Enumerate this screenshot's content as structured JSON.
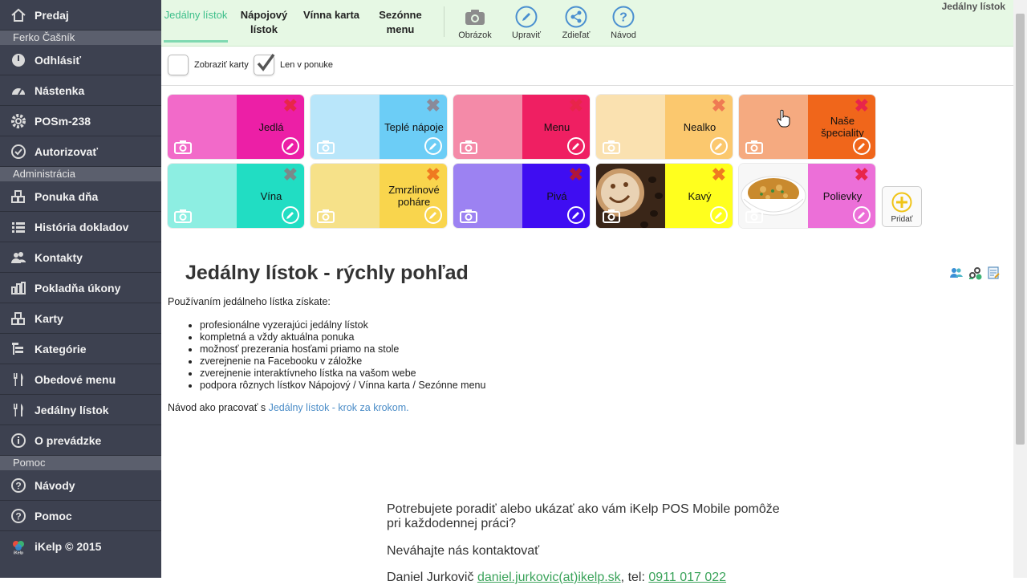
{
  "sidebar": {
    "items": [
      {
        "label": "Predaj",
        "icon": "home-icon"
      },
      {
        "section": "Ferko Čašník"
      },
      {
        "label": "Odhlásiť",
        "icon": "power-icon"
      },
      {
        "label": "Nástenka",
        "icon": "dashboard-icon"
      },
      {
        "label": "POSm-238",
        "icon": "gear-icon"
      },
      {
        "label": "Autorizovať",
        "icon": "check-circle-icon"
      },
      {
        "section": "Administrácia"
      },
      {
        "label": "Ponuka dňa",
        "icon": "blocks-star-icon"
      },
      {
        "label": "História dokladov",
        "icon": "list-icon"
      },
      {
        "label": "Kontakty",
        "icon": "users-icon"
      },
      {
        "label": "Pokladňa úkony",
        "icon": "bars-icon"
      },
      {
        "label": "Karty",
        "icon": "boxes-icon"
      },
      {
        "label": "Kategórie",
        "icon": "tree-icon"
      },
      {
        "label": "Obedové menu",
        "icon": "cutlery-icon"
      },
      {
        "label": "Jedálny lístok",
        "icon": "cutlery-icon"
      },
      {
        "label": "O prevádzke",
        "icon": "info-icon"
      },
      {
        "section": "Pomoc"
      },
      {
        "label": "Návody",
        "icon": "question-icon"
      },
      {
        "label": "Pomoc",
        "icon": "question-icon"
      },
      {
        "label": "iKelp © 2015",
        "icon": "ikelp-logo",
        "logo_text": "iKelp"
      }
    ]
  },
  "topbar": {
    "tabs": [
      {
        "label": "Jedálny lístok",
        "active": true
      },
      {
        "label": "Nápojový lístok"
      },
      {
        "label": "Vínna karta"
      },
      {
        "label": "Sezónne menu"
      }
    ],
    "tools": [
      {
        "label": "Obrázok",
        "icon": "camera-icon"
      },
      {
        "label": "Upraviť",
        "icon": "pencil-icon"
      },
      {
        "label": "Zdieľať",
        "icon": "share-icon"
      },
      {
        "label": "Návod",
        "icon": "help-icon"
      }
    ],
    "title": "Jedálny lístok"
  },
  "filters": {
    "show_cards": "Zobraziť karty",
    "show_cards_checked": false,
    "only_in_menu": "Len v ponuke",
    "only_in_menu_checked": true
  },
  "tiles": [
    {
      "label": "Jedlá",
      "left": "#f26ac9",
      "right": "#ec1fa6",
      "x": "#e8254a"
    },
    {
      "label": "Teplé nápoje",
      "left": "#b9e6fa",
      "right": "#6ccdf6",
      "x": "#8a8a99"
    },
    {
      "label": "Menu",
      "left": "#f48aa8",
      "right": "#ef1f62",
      "x": "#e8254a"
    },
    {
      "label": "Nealko",
      "left": "#fae1b0",
      "right": "#fbc86e",
      "x": "#ef7a53"
    },
    {
      "label": "Naše špeciality",
      "left": "#f5aa80",
      "right": "#f0661b",
      "x": "#e8254a"
    },
    {
      "label": "Vína",
      "left": "#8deee2",
      "right": "#21ddc3",
      "x": "#7a8a8a"
    },
    {
      "label": "Zmrzlinové poháre",
      "left": "#f6e189",
      "right": "#f9d54d",
      "x": "#ef7a20"
    },
    {
      "label": "Pivá",
      "left": "#9c82f2",
      "right": "#3f0df2",
      "x": "#b0163a"
    },
    {
      "label": "Kavý",
      "left": "#6b4a32",
      "right": "#ffff1e",
      "x": "#ef7a20",
      "photo": "coffee"
    },
    {
      "label": "Polievky",
      "left": "#f4f4f4",
      "right": "#ec6fd8",
      "x": "#e8254a",
      "photo": "soup"
    }
  ],
  "add_label": "Pridať",
  "content": {
    "heading": "Jedálny lístok - rýchly pohľad",
    "intro": "Používaním jedálneho lístka získate:",
    "benefits": [
      "profesionálne vyzerajúci jedálny lístok",
      "kompletná a vždy aktuálna ponuka",
      "možnosť prezerania hosťami priamo na stole",
      "zverejnenie na Facebooku v záložke",
      "zverejnenie interaktívneho lístka na vašom webe",
      "podpora rôznych lístkov Nápojový / Vínna karta / Sezónne menu"
    ],
    "guide_prefix": "Návod ako pracovať s ",
    "guide_link": "Jedálny lístok - krok za krokom.",
    "contact_line1": "Potrebujete poradiť alebo ukázať ako vám iKelp POS Mobile pomôže",
    "contact_line2": "pri každodennej práci?",
    "contact_line3": "Neváhajte nás kontaktovať",
    "contact_name": "Daniel Jurkovič",
    "contact_email": "daniel.jurkovic(at)ikelp.sk",
    "contact_tel_label": ", tel: ",
    "contact_tel": "0911 017 022"
  }
}
